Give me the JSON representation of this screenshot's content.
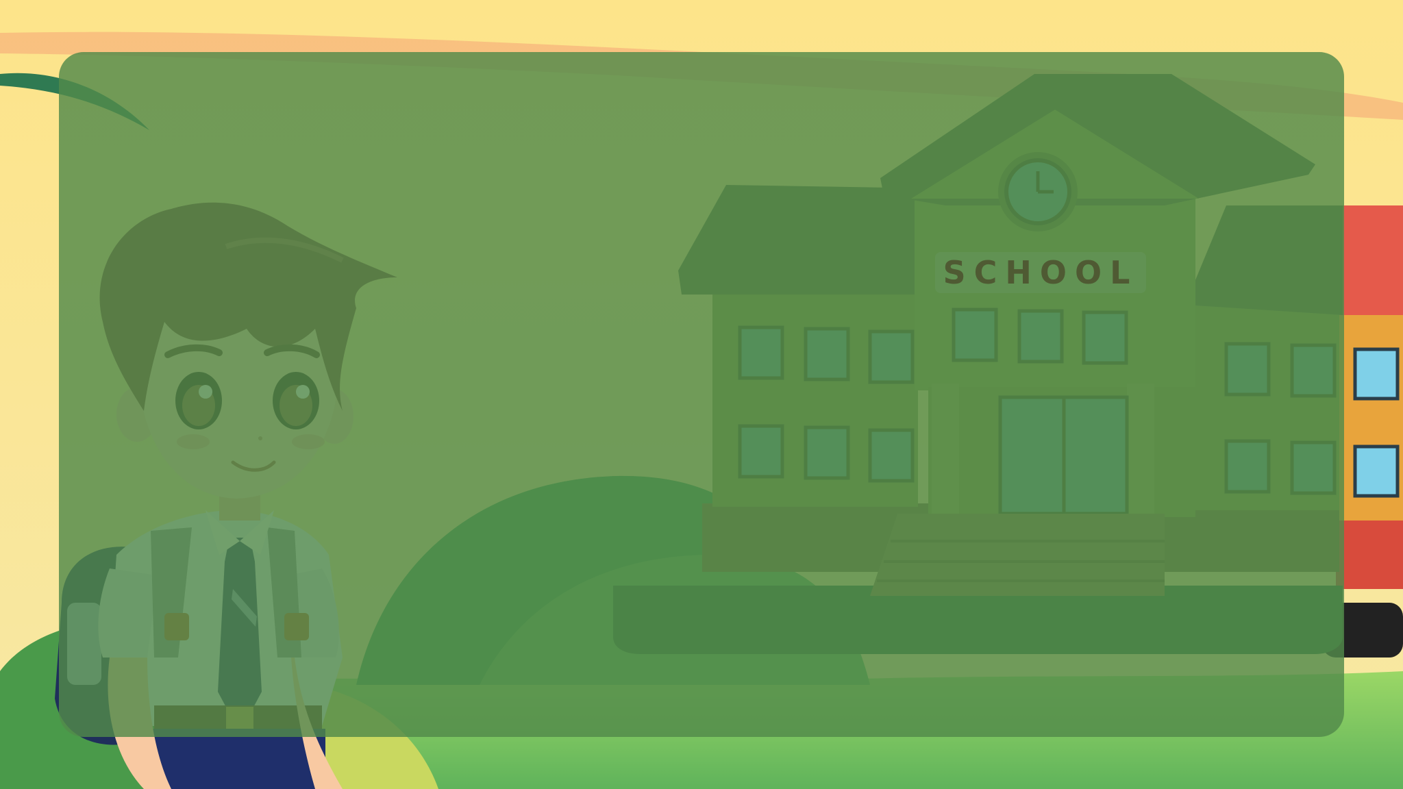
{
  "scene": {
    "sign_text": "SCHOOL"
  },
  "colors": {
    "sky_top": "#fde48a",
    "sky_bottom": "#f8e79a",
    "panel_overlay": "#528a4a",
    "grass_light": "#8fd35c",
    "grass_dark": "#3c8a42",
    "school_wall": "#8c9d3f",
    "school_roof": "#5f6b3a",
    "window_blue": "#5fa79a",
    "neighbor_building": "#e8a43c",
    "boy_hair": "#7a3f2e",
    "boy_shirt": "#eef1fb",
    "boy_tie": "#1f2f6b"
  }
}
